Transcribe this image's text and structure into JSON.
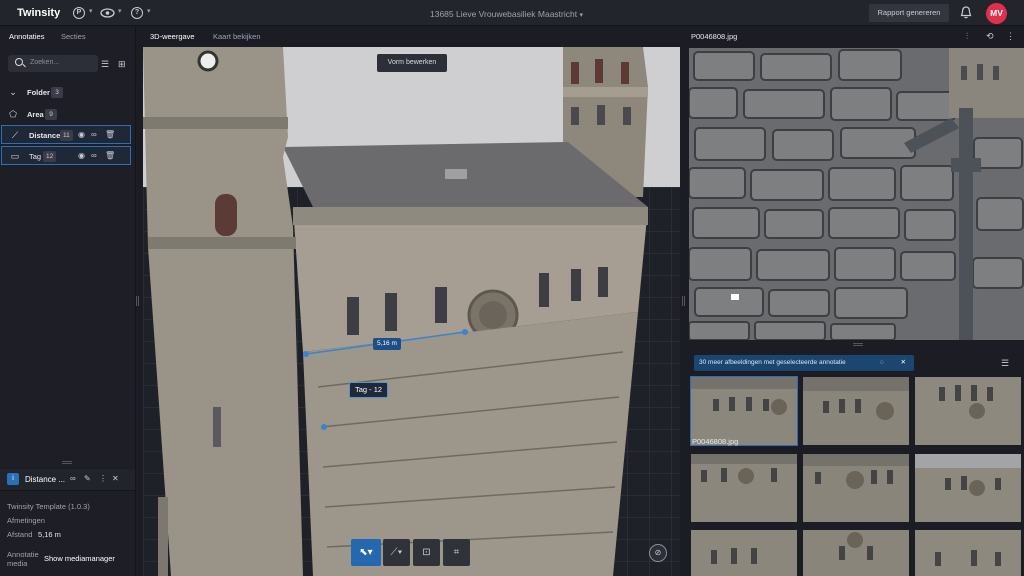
{
  "app": {
    "brand": "Twinsity",
    "title": "13685 Lieve Vrouwebasiliek Maastricht",
    "report_button": "Rapport genereren",
    "user_initials": "MV"
  },
  "top_icons": {
    "p_icon": "P",
    "help_icon": "?"
  },
  "left": {
    "tabs": [
      "Annotaties",
      "Secties"
    ],
    "search_placeholder": "Zoeken...",
    "tree": [
      {
        "label": "Folder",
        "count": "3"
      },
      {
        "label": "Area",
        "count": "9"
      },
      {
        "label": "Distance",
        "count": "11"
      },
      {
        "label": "Tag",
        "count": "12"
      }
    ],
    "detail": {
      "title": "Distance ...",
      "template": "Twinsity Template (1.0.3)",
      "section": "Afmetingen",
      "field_label": "Afstand",
      "field_value": "5,16 m",
      "media_label": "Annotatie media",
      "media_button": "Show mediamanager"
    }
  },
  "center": {
    "tabs": [
      "3D-weergave",
      "Kaart bekijken"
    ],
    "edit_button": "Vorm bewerken",
    "tag_label": "Tag - 12",
    "distance_label": "5,16 m"
  },
  "right": {
    "image_name": "P0046808.jpg",
    "banner": "30 meer afbeeldingen met geselecteerde annotatie",
    "thumb_caption": "P0046808.jpg"
  },
  "colors": {
    "accent": "#2468b0",
    "avatar": "#e0304e",
    "bg": "#1c1d24"
  }
}
